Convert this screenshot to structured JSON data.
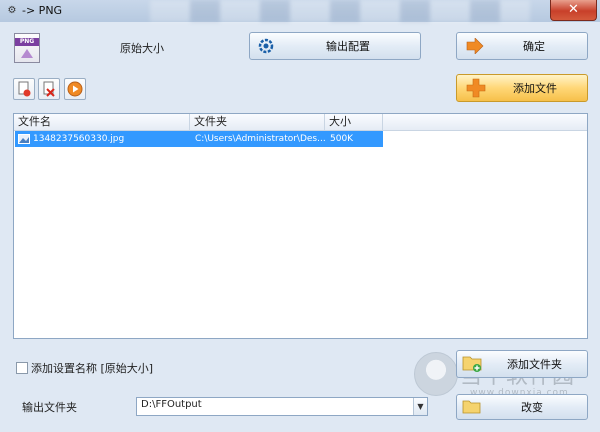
{
  "window": {
    "title": "-> PNG",
    "close_glyph": "✕"
  },
  "header": {
    "size_label": "原始大小"
  },
  "buttons": {
    "output_config": "输出配置",
    "ok": "确定",
    "add_file": "添加文件",
    "add_folder": "添加文件夹",
    "change": "改变"
  },
  "toolbar_icons": [
    "remove-file-icon",
    "clear-list-icon",
    "play-icon"
  ],
  "file_list": {
    "columns": [
      "文件名",
      "文件夹",
      "大小"
    ],
    "rows": [
      {
        "name": "1348237560330.jpg",
        "folder": "C:\\Users\\Administrator\\Des...",
        "size": "500K"
      }
    ]
  },
  "options": {
    "add_setting_name_label": "添加设置名称 [原始大小]"
  },
  "output": {
    "label": "输出文件夹",
    "path": "D:\\FFOutput"
  },
  "watermark": {
    "text": "当下软件园",
    "url": "www.downxia.com"
  },
  "colors": {
    "selection": "#3399ff",
    "accent_orange": "#f6c04a",
    "window_bg": "#dfe8f3"
  }
}
